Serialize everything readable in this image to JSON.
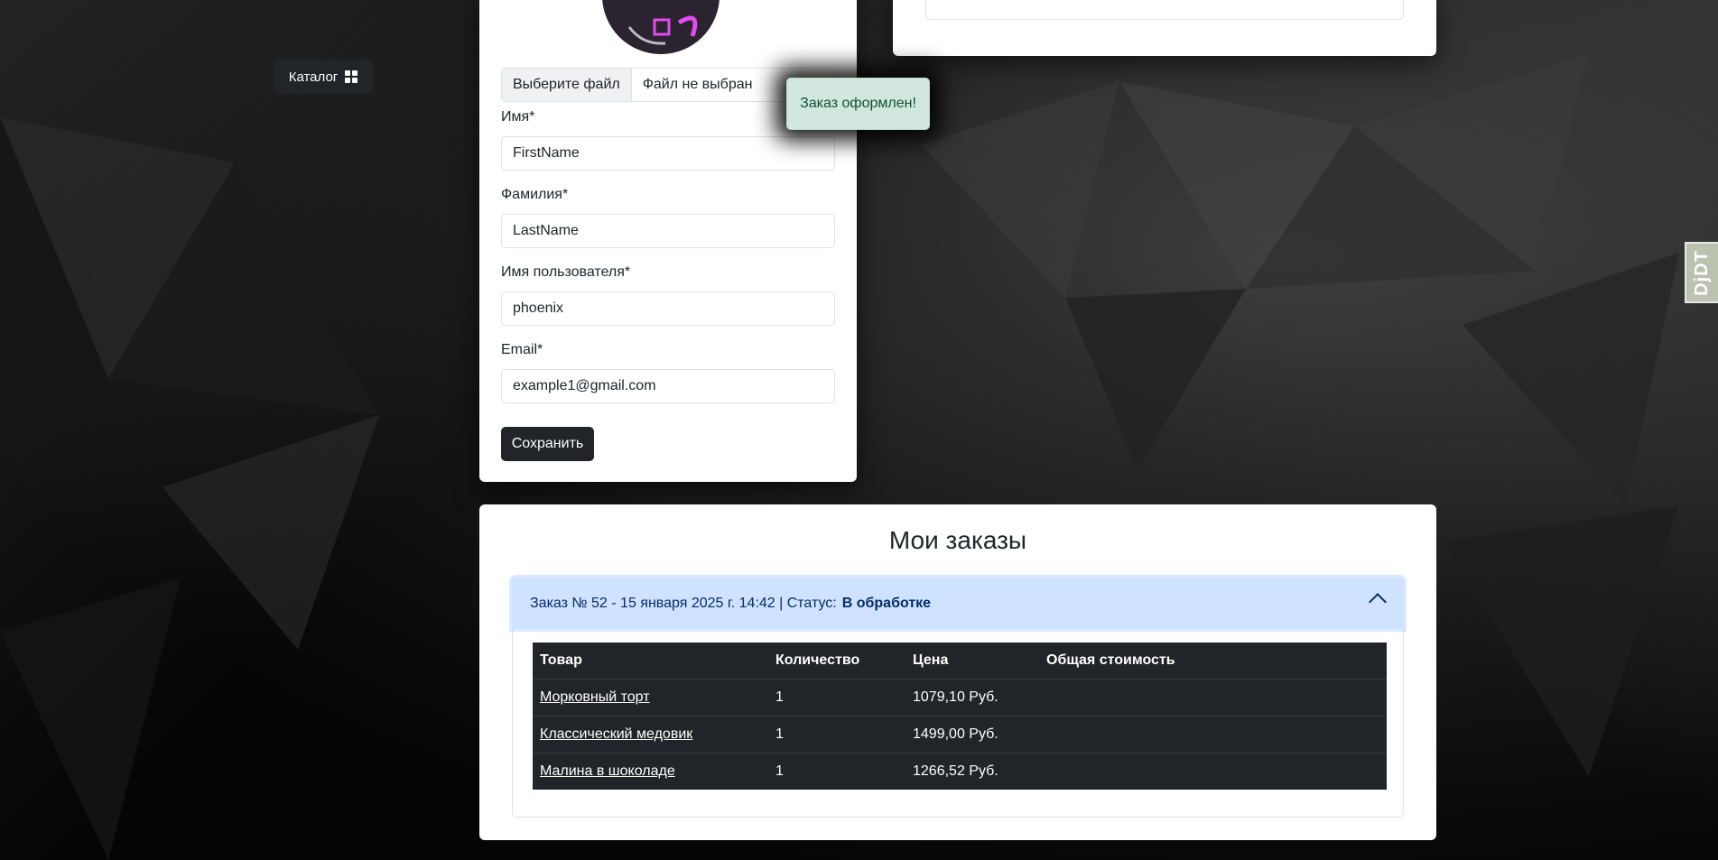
{
  "nav": {
    "catalog_label": "Каталог"
  },
  "profile": {
    "file_button": "Выберите файл",
    "file_status": "Файл не выбран",
    "first_name_label": "Имя*",
    "first_name_value": "FirstName",
    "last_name_label": "Фамилия*",
    "last_name_value": "LastName",
    "username_label": "Имя пользователя*",
    "username_value": "phoenix",
    "email_label": "Email*",
    "email_value": "example1@gmail.com",
    "save_label": "Сохранить"
  },
  "toast": {
    "message": "Заказ оформлен!"
  },
  "orders": {
    "title": "Мои заказы",
    "order_header": "Заказ № 52 - 15 января 2025 г. 14:42 | Статус:",
    "order_status": "В обработке",
    "columns": [
      "Товар",
      "Количество",
      "Цена",
      "Общая стоимость"
    ],
    "rows": [
      {
        "product": "Морковный торт",
        "qty": "1",
        "price": "1079,10 Руб.",
        "total": ""
      },
      {
        "product": "Классический медовик",
        "qty": "1",
        "price": "1499,00 Руб.",
        "total": ""
      },
      {
        "product": "Малина в шоколаде",
        "qty": "1",
        "price": "1266,52 Руб.",
        "total": ""
      }
    ]
  },
  "badge": {
    "label": "DjDT"
  },
  "colors": {
    "dark": "#212529",
    "accordion_active": "#cfe2ff",
    "toast_bg": "#d1e7dd"
  }
}
